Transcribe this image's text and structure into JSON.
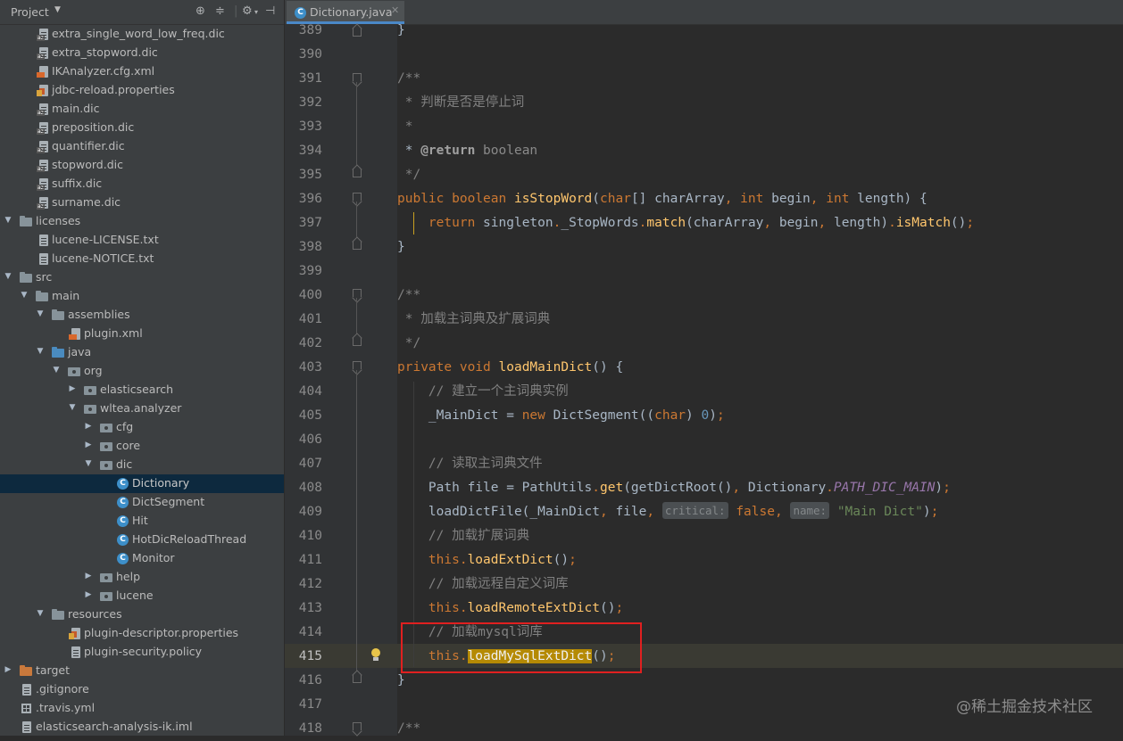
{
  "project_panel": {
    "title": "Project",
    "toolbar_icons": [
      "target-icon",
      "collapse-icon",
      "gear-icon",
      "hide-icon"
    ],
    "tree": [
      {
        "label": "extra_single_word_low_freq.dic",
        "icon": "dic-file-icon"
      },
      {
        "label": "extra_stopword.dic",
        "icon": "dic-file-icon"
      },
      {
        "label": "IKAnalyzer.cfg.xml",
        "icon": "xml-file-icon"
      },
      {
        "label": "jdbc-reload.properties",
        "icon": "properties-file-icon"
      },
      {
        "label": "main.dic",
        "icon": "dic-file-icon"
      },
      {
        "label": "preposition.dic",
        "icon": "dic-file-icon"
      },
      {
        "label": "quantifier.dic",
        "icon": "dic-file-icon"
      },
      {
        "label": "stopword.dic",
        "icon": "dic-file-icon"
      },
      {
        "label": "suffix.dic",
        "icon": "dic-file-icon"
      },
      {
        "label": "surname.dic",
        "icon": "dic-file-icon"
      },
      {
        "label": "licenses",
        "icon": "folder-icon",
        "expanded": true
      },
      {
        "label": "lucene-LICENSE.txt",
        "icon": "text-file-icon"
      },
      {
        "label": "lucene-NOTICE.txt",
        "icon": "text-file-icon"
      },
      {
        "label": "src",
        "icon": "folder-icon",
        "expanded": true
      },
      {
        "label": "main",
        "icon": "folder-icon",
        "expanded": true
      },
      {
        "label": "assemblies",
        "icon": "folder-icon",
        "expanded": true
      },
      {
        "label": "plugin.xml",
        "icon": "xml-file-icon"
      },
      {
        "label": "java",
        "icon": "source-folder-icon",
        "expanded": true
      },
      {
        "label": "org",
        "icon": "package-icon",
        "expanded": true
      },
      {
        "label": "elasticsearch",
        "icon": "package-icon",
        "expanded": false
      },
      {
        "label": "wltea.analyzer",
        "icon": "package-icon",
        "expanded": true
      },
      {
        "label": "cfg",
        "icon": "package-icon",
        "expanded": false
      },
      {
        "label": "core",
        "icon": "package-icon",
        "expanded": false
      },
      {
        "label": "dic",
        "icon": "package-icon",
        "expanded": true
      },
      {
        "label": "Dictionary",
        "icon": "class-icon",
        "selected": true
      },
      {
        "label": "DictSegment",
        "icon": "class-icon"
      },
      {
        "label": "Hit",
        "icon": "class-icon"
      },
      {
        "label": "HotDicReloadThread",
        "icon": "class-icon"
      },
      {
        "label": "Monitor",
        "icon": "class-icon"
      },
      {
        "label": "help",
        "icon": "package-icon",
        "expanded": false
      },
      {
        "label": "lucene",
        "icon": "package-icon",
        "expanded": false
      },
      {
        "label": "resources",
        "icon": "resources-folder-icon",
        "expanded": true
      },
      {
        "label": "plugin-descriptor.properties",
        "icon": "properties-file-icon"
      },
      {
        "label": "plugin-security.policy",
        "icon": "text-file-icon"
      },
      {
        "label": "target",
        "icon": "excluded-folder-icon",
        "expanded": false
      },
      {
        "label": ".gitignore",
        "icon": "text-file-icon"
      },
      {
        "label": ".travis.yml",
        "icon": "yml-file-icon"
      },
      {
        "label": "elasticsearch-analysis-ik.iml",
        "icon": "iml-file-icon"
      }
    ]
  },
  "editor": {
    "tab_label": "Dictionary.java",
    "class_badge": "C",
    "current_line": 415,
    "lines": [
      {
        "n": "389",
        "t": "}"
      },
      {
        "n": "390",
        "t": ""
      },
      {
        "n": "391",
        "t": "/**"
      },
      {
        "n": "392",
        "t": " * 判断是否是停止词"
      },
      {
        "n": "393",
        "t": " *"
      },
      {
        "n": "394",
        "t": " * @return boolean"
      },
      {
        "n": "395",
        "t": " */"
      },
      {
        "n": "396",
        "t": "public boolean isStopWord(char[] charArray, int begin, int length) {"
      },
      {
        "n": "397",
        "t": "    return singleton._StopWords.match(charArray, begin, length).isMatch();"
      },
      {
        "n": "398",
        "t": "}"
      },
      {
        "n": "399",
        "t": ""
      },
      {
        "n": "400",
        "t": "/**"
      },
      {
        "n": "401",
        "t": " * 加载主词典及扩展词典"
      },
      {
        "n": "402",
        "t": " */"
      },
      {
        "n": "403",
        "t": "private void loadMainDict() {"
      },
      {
        "n": "404",
        "t": "    // 建立一个主词典实例"
      },
      {
        "n": "405",
        "t": "    _MainDict = new DictSegment((char) 0);"
      },
      {
        "n": "406",
        "t": ""
      },
      {
        "n": "407",
        "t": "    // 读取主词典文件"
      },
      {
        "n": "408",
        "t": "    Path file = PathUtils.get(getDictRoot(), Dictionary.PATH_DIC_MAIN);"
      },
      {
        "n": "409",
        "t": "    loadDictFile(_MainDict, file, critical: false, name: \"Main Dict\");"
      },
      {
        "n": "410",
        "t": "    // 加载扩展词典"
      },
      {
        "n": "411",
        "t": "    this.loadExtDict();"
      },
      {
        "n": "412",
        "t": "    // 加载远程自定义词库"
      },
      {
        "n": "413",
        "t": "    this.loadRemoteExtDict();"
      },
      {
        "n": "414",
        "t": "    // 加载mysql词库"
      },
      {
        "n": "415",
        "t": "    this.loadMySqlExtDict();"
      },
      {
        "n": "416",
        "t": "}"
      },
      {
        "n": "417",
        "t": ""
      },
      {
        "n": "418",
        "t": "/**"
      }
    ],
    "param_hints": {
      "critical": "critical:",
      "name": "name:"
    }
  },
  "watermark": "@稀土掘金技术社区",
  "colors": {
    "keyword": "#cc7832",
    "method": "#ffc66d",
    "comment": "#808080",
    "field": "#9876aa",
    "string": "#6a8759",
    "number": "#6897bb",
    "highlight_box": "#e02020",
    "selection": "#0d293e"
  }
}
